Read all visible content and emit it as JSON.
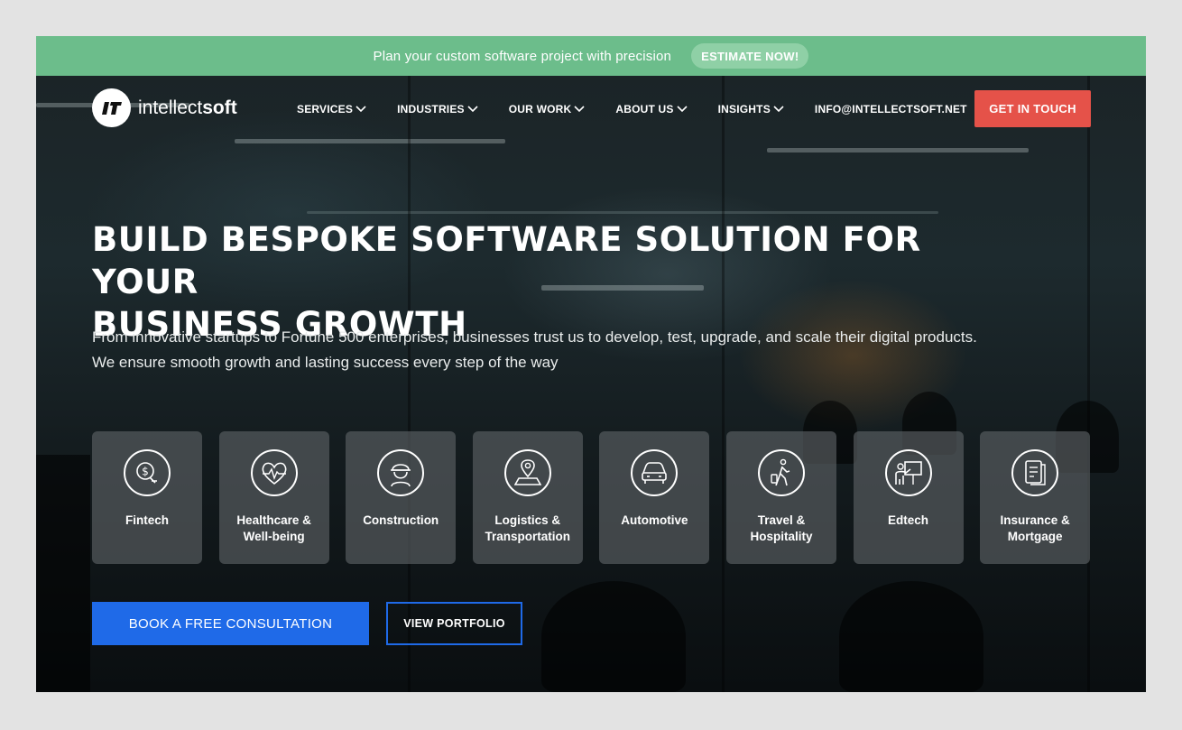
{
  "promo": {
    "text": "Plan your custom software project with precision",
    "button": "ESTIMATE NOW!"
  },
  "brand": {
    "name_light": "intellect",
    "name_bold": "soft",
    "mark_text": "IT",
    "accent": "#e55249",
    "promo_color": "#6cbd8b",
    "primary": "#1f6ae8"
  },
  "nav": {
    "items": [
      {
        "label": "SERVICES",
        "dropdown": true
      },
      {
        "label": "INDUSTRIES",
        "dropdown": true
      },
      {
        "label": "OUR WORK",
        "dropdown": true
      },
      {
        "label": "ABOUT US",
        "dropdown": true
      },
      {
        "label": "INSIGHTS",
        "dropdown": true
      },
      {
        "label": "INFO@INTELLECTSOFT.NET",
        "dropdown": false
      }
    ],
    "cta": "GET IN TOUCH"
  },
  "hero": {
    "headline_line1": "BUILD BESPOKE SOFTWARE SOLUTION FOR YOUR",
    "headline_line2": "BUSINESS GROWTH",
    "subline_line1": "From innovative startups to Fortune 500 enterprises, businesses trust us to develop, test, upgrade, and scale their digital products.",
    "subline_line2": "We ensure smooth growth and lasting success every step of the way"
  },
  "industries": [
    {
      "line1": "Fintech",
      "line2": "",
      "icon": "fintech-icon"
    },
    {
      "line1": "Healthcare &",
      "line2": "Well-being",
      "icon": "heart-pulse-icon"
    },
    {
      "line1": "Construction",
      "line2": "",
      "icon": "hardhat-worker-icon"
    },
    {
      "line1": "Logistics &",
      "line2": "Transportation",
      "icon": "map-pin-icon"
    },
    {
      "line1": "Automotive",
      "line2": "",
      "icon": "car-icon"
    },
    {
      "line1": "Travel &",
      "line2": "Hospitality",
      "icon": "traveler-icon"
    },
    {
      "line1": "Edtech",
      "line2": "",
      "icon": "teacher-board-icon"
    },
    {
      "line1": "Insurance &",
      "line2": "Mortgage",
      "icon": "document-icon"
    }
  ],
  "actions": {
    "primary": "BOOK A FREE CONSULTATION",
    "secondary": "VIEW PORTFOLIO"
  }
}
